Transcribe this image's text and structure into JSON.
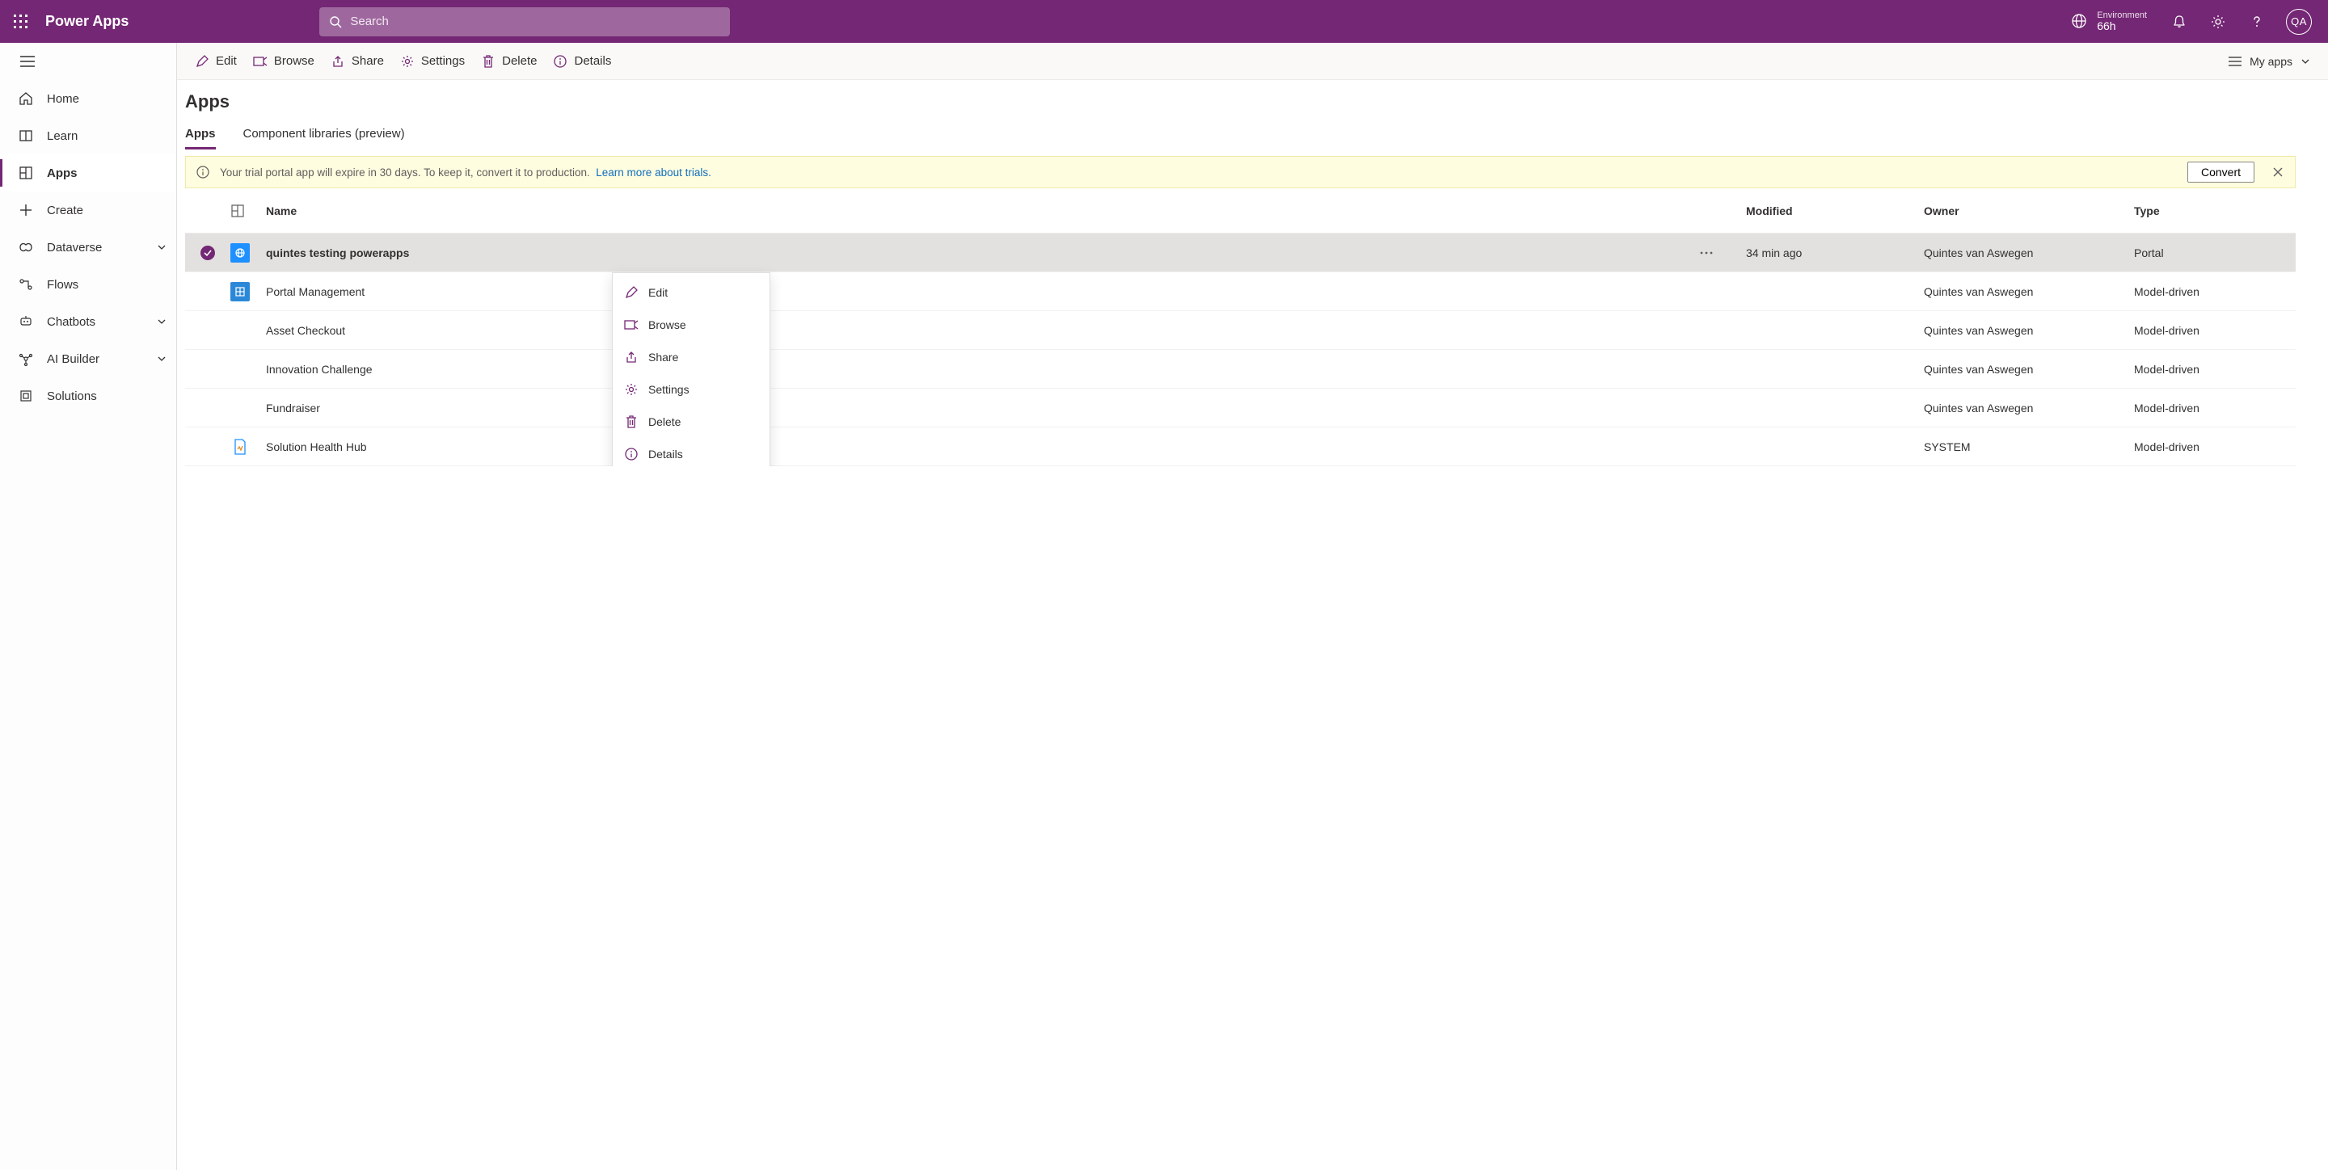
{
  "header": {
    "product": "Power Apps",
    "search_placeholder": "Search",
    "env_label": "Environment",
    "env_name": "66h",
    "avatar": "QA"
  },
  "sidebar": {
    "items": [
      {
        "label": "Home"
      },
      {
        "label": "Learn"
      },
      {
        "label": "Apps"
      },
      {
        "label": "Create"
      },
      {
        "label": "Dataverse"
      },
      {
        "label": "Flows"
      },
      {
        "label": "Chatbots"
      },
      {
        "label": "AI Builder"
      },
      {
        "label": "Solutions"
      }
    ]
  },
  "cmdbar": {
    "edit": "Edit",
    "browse": "Browse",
    "share": "Share",
    "settings": "Settings",
    "delete": "Delete",
    "details": "Details",
    "views": "My apps"
  },
  "page": {
    "title": "Apps",
    "tabs": {
      "apps": "Apps",
      "complib": "Component libraries (preview)"
    },
    "banner": {
      "text": "Your trial portal app will expire in 30 days. To keep it, convert it to production.",
      "link": "Learn more about trials.",
      "convert": "Convert"
    },
    "columns": {
      "name": "Name",
      "modified": "Modified",
      "owner": "Owner",
      "type": "Type"
    },
    "rows": [
      {
        "name": "quintes testing powerapps",
        "modified": "34 min ago",
        "owner": "Quintes van Aswegen",
        "type": "Portal"
      },
      {
        "name": "Portal Management",
        "modified": "",
        "owner": "Quintes van Aswegen",
        "type": "Model-driven"
      },
      {
        "name": "Asset Checkout",
        "modified": "",
        "owner": "Quintes van Aswegen",
        "type": "Model-driven"
      },
      {
        "name": "Innovation Challenge",
        "modified": "",
        "owner": "Quintes van Aswegen",
        "type": "Model-driven"
      },
      {
        "name": "Fundraiser",
        "modified": "",
        "owner": "Quintes van Aswegen",
        "type": "Model-driven"
      },
      {
        "name": "Solution Health Hub",
        "modified": "",
        "owner": "SYSTEM",
        "type": "Model-driven"
      }
    ],
    "context_menu": {
      "edit": "Edit",
      "browse": "Browse",
      "share": "Share",
      "settings": "Settings",
      "delete": "Delete",
      "details": "Details"
    }
  }
}
